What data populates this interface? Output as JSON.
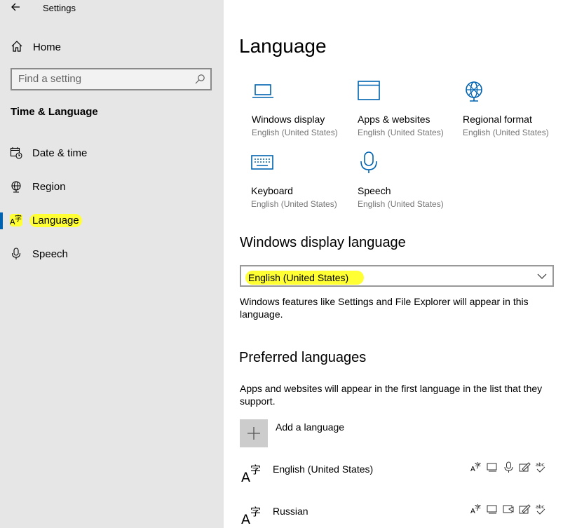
{
  "window": {
    "title": "Settings"
  },
  "sidebar": {
    "home_label": "Home",
    "search_placeholder": "Find a setting",
    "section_title": "Time & Language",
    "items": [
      {
        "label": "Date & time",
        "icon": "calendar-clock-icon"
      },
      {
        "label": "Region",
        "icon": "globe-icon"
      },
      {
        "label": "Language",
        "icon": "language-icon",
        "active": true
      },
      {
        "label": "Speech",
        "icon": "microphone-icon"
      }
    ],
    "highlight_color": "#ffff34",
    "accent": "#0063b1"
  },
  "main": {
    "title": "Language",
    "tiles": [
      {
        "label": "Windows display",
        "sub": "English (United States)",
        "icon": "laptop-icon"
      },
      {
        "label": "Apps & websites",
        "sub": "English (United States)",
        "icon": "window-icon"
      },
      {
        "label": "Regional format",
        "sub": "English (United States)",
        "icon": "globe-icon"
      },
      {
        "label": "Keyboard",
        "sub": "English (United States)",
        "icon": "keyboard-icon"
      },
      {
        "label": "Speech",
        "sub": "English (United States)",
        "icon": "microphone-icon"
      }
    ],
    "display_language": {
      "heading": "Windows display language",
      "selected": "English (United States)",
      "description": "Windows features like Settings and File Explorer will appear in this language."
    },
    "preferred": {
      "heading": "Preferred languages",
      "description": "Apps and websites will appear in the first language in the list that they support.",
      "add_label": "Add a language",
      "languages": [
        {
          "name": "English (United States)"
        },
        {
          "name": "Russian"
        }
      ]
    }
  }
}
